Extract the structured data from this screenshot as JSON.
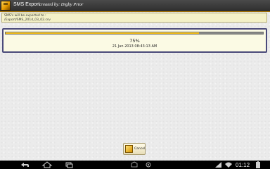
{
  "app": {
    "title": "SMS Export",
    "credit": "created by: Digby Prior"
  },
  "info": {
    "line1": "SMS's will be exported to :",
    "line2": "/Export/SMS_2014_03_02.csv"
  },
  "progress": {
    "fraction": 0.75,
    "percent_label": "75%",
    "timestamp": "21 Jun 2013 08:43:13 AM"
  },
  "actions": {
    "cancel_label": "Cancel"
  },
  "system_bar": {
    "time": "01:12"
  },
  "colors": {
    "accent": "#f2b400",
    "panel_border": "#4a4a7a",
    "title_bar": "#3a3a3a"
  }
}
